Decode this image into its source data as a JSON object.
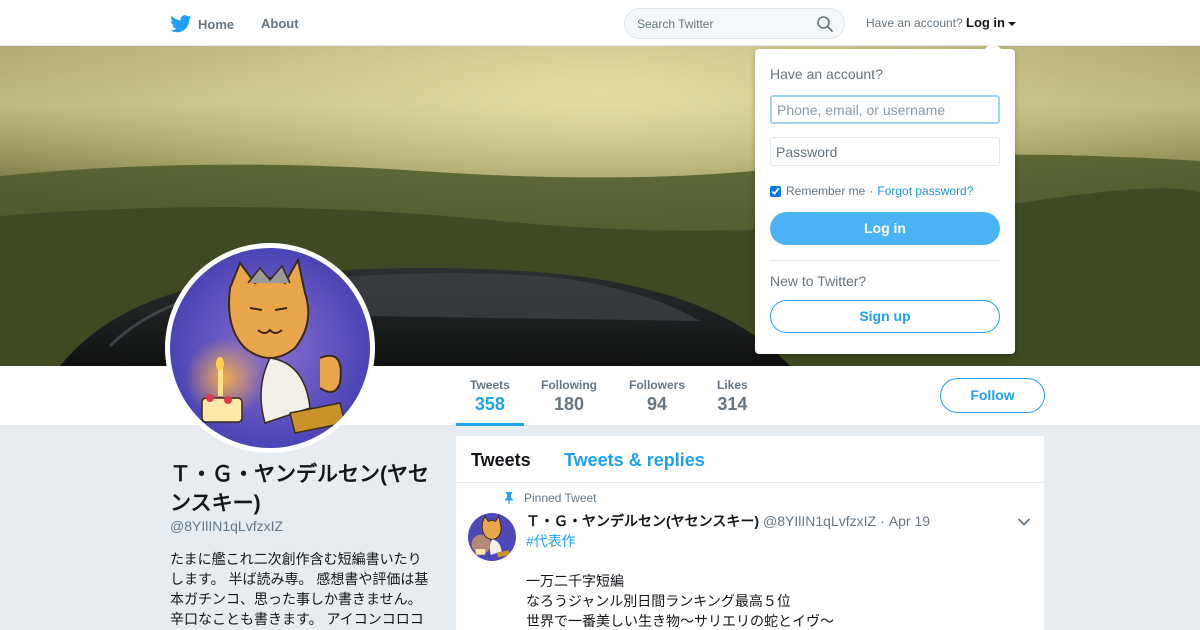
{
  "nav": {
    "home_label": "Home",
    "about_label": "About",
    "search_placeholder": "Search Twitter",
    "have_account_text": "Have an account?",
    "login_label": "Log in"
  },
  "profile": {
    "name": "Ｔ・Ｇ・ヤンデルセン(ヤセンスキー)",
    "handle": "@8YIlIN1qLvfzxIZ",
    "bio": "たまに艦これ二次創作含む短編書いたりします。 半ば読み専。 感想書や評価は基本ガチンコ、思った事しか書きません。辛口なことも書きます。 アイコンコロコ",
    "follow_label": "Follow",
    "stats": [
      {
        "label": "Tweets",
        "value": "358",
        "active": true
      },
      {
        "label": "Following",
        "value": "180",
        "active": false
      },
      {
        "label": "Followers",
        "value": "94",
        "active": false
      },
      {
        "label": "Likes",
        "value": "314",
        "active": false
      }
    ]
  },
  "timeline": {
    "tabs": [
      "Tweets",
      "Tweets & replies"
    ],
    "pinned_label": "Pinned Tweet",
    "tweet": {
      "name": "Ｔ・Ｇ・ヤンデルセン(ヤセンスキー)",
      "handle": "@8YIlIN1qLvfzxIZ",
      "dot": "·",
      "date": "Apr 19",
      "hashtag": "#代表作",
      "lines": [
        "一万二千字短編",
        "なろうジャンル別日間ランキング最高５位",
        "世界で一番美しい生き物～サリエリの蛇とイヴ～"
      ]
    }
  },
  "login_dropdown": {
    "heading": "Have an account?",
    "username_placeholder": "Phone, email, or username",
    "password_placeholder": "Password",
    "remember_label": "Remember me",
    "separator": "·",
    "forgot_label": "Forgot password?",
    "login_button": "Log in",
    "new_to_twitter": "New to Twitter?",
    "signup_button": "Sign up"
  },
  "colors": {
    "accent": "#1da1f2",
    "login_button_bg": "#4ab3f4",
    "page_bg": "#e6ecf0"
  },
  "icons": [
    "twitter-bird-icon",
    "search-icon",
    "caret-down-icon",
    "pin-icon",
    "chevron-down-icon"
  ]
}
